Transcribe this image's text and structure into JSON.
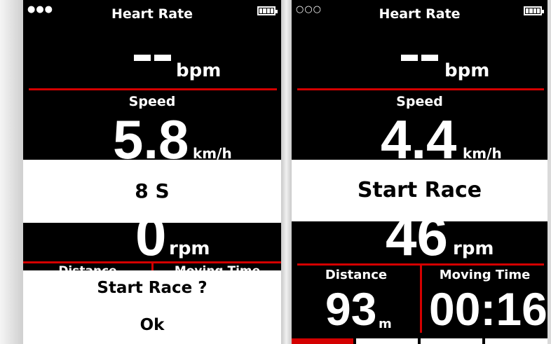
{
  "left_screen": {
    "status_dots": "●●●",
    "title": "Heart Rate",
    "heart_rate_value": "--",
    "heart_rate_unit": "bpm",
    "speed_label": "Speed",
    "speed_value": "5.8",
    "speed_unit": "km/h",
    "countdown_text": "8 S",
    "cadence_value": "0",
    "cadence_unit": "rpm",
    "distance_label": "Distance",
    "moving_time_label": "Moving Time",
    "dialog_question": "Start Race ?",
    "dialog_ok": "Ok"
  },
  "right_screen": {
    "status_dots": "○○○",
    "title": "Heart Rate",
    "heart_rate_value": "--",
    "heart_rate_unit": "bpm",
    "speed_label": "Speed",
    "speed_value": "4.4",
    "speed_unit": "km/h",
    "banner_text": "Start Race",
    "cadence_value": "46",
    "cadence_unit": "rpm",
    "distance_label": "Distance",
    "distance_value": "93",
    "distance_unit": "m",
    "moving_time_label": "Moving Time",
    "moving_time_value": "00:16"
  },
  "colors": {
    "accent_red": "#d40000",
    "screen_bg": "#000000",
    "text": "#ffffff"
  },
  "icons": {
    "battery": "battery-icon",
    "status": "status-dots-icon"
  }
}
